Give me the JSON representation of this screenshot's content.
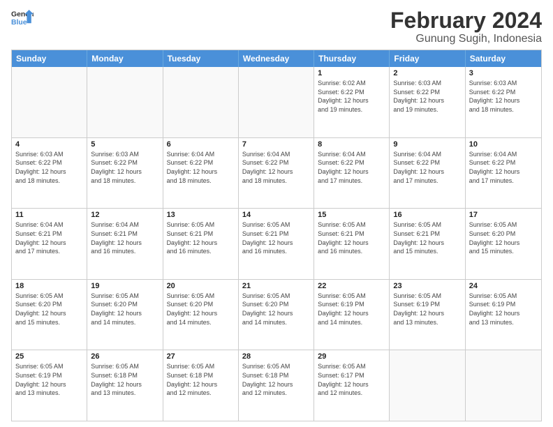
{
  "logo": {
    "line1": "General",
    "line2": "Blue"
  },
  "title": "February 2024",
  "subtitle": "Gunung Sugih, Indonesia",
  "days": [
    "Sunday",
    "Monday",
    "Tuesday",
    "Wednesday",
    "Thursday",
    "Friday",
    "Saturday"
  ],
  "rows": [
    [
      {
        "day": "",
        "empty": true
      },
      {
        "day": "",
        "empty": true
      },
      {
        "day": "",
        "empty": true
      },
      {
        "day": "",
        "empty": true
      },
      {
        "day": "1",
        "info": "Sunrise: 6:02 AM\nSunset: 6:22 PM\nDaylight: 12 hours\nand 19 minutes."
      },
      {
        "day": "2",
        "info": "Sunrise: 6:03 AM\nSunset: 6:22 PM\nDaylight: 12 hours\nand 19 minutes."
      },
      {
        "day": "3",
        "info": "Sunrise: 6:03 AM\nSunset: 6:22 PM\nDaylight: 12 hours\nand 18 minutes."
      }
    ],
    [
      {
        "day": "4",
        "info": "Sunrise: 6:03 AM\nSunset: 6:22 PM\nDaylight: 12 hours\nand 18 minutes."
      },
      {
        "day": "5",
        "info": "Sunrise: 6:03 AM\nSunset: 6:22 PM\nDaylight: 12 hours\nand 18 minutes."
      },
      {
        "day": "6",
        "info": "Sunrise: 6:04 AM\nSunset: 6:22 PM\nDaylight: 12 hours\nand 18 minutes."
      },
      {
        "day": "7",
        "info": "Sunrise: 6:04 AM\nSunset: 6:22 PM\nDaylight: 12 hours\nand 18 minutes."
      },
      {
        "day": "8",
        "info": "Sunrise: 6:04 AM\nSunset: 6:22 PM\nDaylight: 12 hours\nand 17 minutes."
      },
      {
        "day": "9",
        "info": "Sunrise: 6:04 AM\nSunset: 6:22 PM\nDaylight: 12 hours\nand 17 minutes."
      },
      {
        "day": "10",
        "info": "Sunrise: 6:04 AM\nSunset: 6:22 PM\nDaylight: 12 hours\nand 17 minutes."
      }
    ],
    [
      {
        "day": "11",
        "info": "Sunrise: 6:04 AM\nSunset: 6:21 PM\nDaylight: 12 hours\nand 17 minutes."
      },
      {
        "day": "12",
        "info": "Sunrise: 6:04 AM\nSunset: 6:21 PM\nDaylight: 12 hours\nand 16 minutes."
      },
      {
        "day": "13",
        "info": "Sunrise: 6:05 AM\nSunset: 6:21 PM\nDaylight: 12 hours\nand 16 minutes."
      },
      {
        "day": "14",
        "info": "Sunrise: 6:05 AM\nSunset: 6:21 PM\nDaylight: 12 hours\nand 16 minutes."
      },
      {
        "day": "15",
        "info": "Sunrise: 6:05 AM\nSunset: 6:21 PM\nDaylight: 12 hours\nand 16 minutes."
      },
      {
        "day": "16",
        "info": "Sunrise: 6:05 AM\nSunset: 6:21 PM\nDaylight: 12 hours\nand 15 minutes."
      },
      {
        "day": "17",
        "info": "Sunrise: 6:05 AM\nSunset: 6:20 PM\nDaylight: 12 hours\nand 15 minutes."
      }
    ],
    [
      {
        "day": "18",
        "info": "Sunrise: 6:05 AM\nSunset: 6:20 PM\nDaylight: 12 hours\nand 15 minutes."
      },
      {
        "day": "19",
        "info": "Sunrise: 6:05 AM\nSunset: 6:20 PM\nDaylight: 12 hours\nand 14 minutes."
      },
      {
        "day": "20",
        "info": "Sunrise: 6:05 AM\nSunset: 6:20 PM\nDaylight: 12 hours\nand 14 minutes."
      },
      {
        "day": "21",
        "info": "Sunrise: 6:05 AM\nSunset: 6:20 PM\nDaylight: 12 hours\nand 14 minutes."
      },
      {
        "day": "22",
        "info": "Sunrise: 6:05 AM\nSunset: 6:19 PM\nDaylight: 12 hours\nand 14 minutes."
      },
      {
        "day": "23",
        "info": "Sunrise: 6:05 AM\nSunset: 6:19 PM\nDaylight: 12 hours\nand 13 minutes."
      },
      {
        "day": "24",
        "info": "Sunrise: 6:05 AM\nSunset: 6:19 PM\nDaylight: 12 hours\nand 13 minutes."
      }
    ],
    [
      {
        "day": "25",
        "info": "Sunrise: 6:05 AM\nSunset: 6:19 PM\nDaylight: 12 hours\nand 13 minutes."
      },
      {
        "day": "26",
        "info": "Sunrise: 6:05 AM\nSunset: 6:18 PM\nDaylight: 12 hours\nand 13 minutes."
      },
      {
        "day": "27",
        "info": "Sunrise: 6:05 AM\nSunset: 6:18 PM\nDaylight: 12 hours\nand 12 minutes."
      },
      {
        "day": "28",
        "info": "Sunrise: 6:05 AM\nSunset: 6:18 PM\nDaylight: 12 hours\nand 12 minutes."
      },
      {
        "day": "29",
        "info": "Sunrise: 6:05 AM\nSunset: 6:17 PM\nDaylight: 12 hours\nand 12 minutes."
      },
      {
        "day": "",
        "empty": true
      },
      {
        "day": "",
        "empty": true
      }
    ]
  ]
}
